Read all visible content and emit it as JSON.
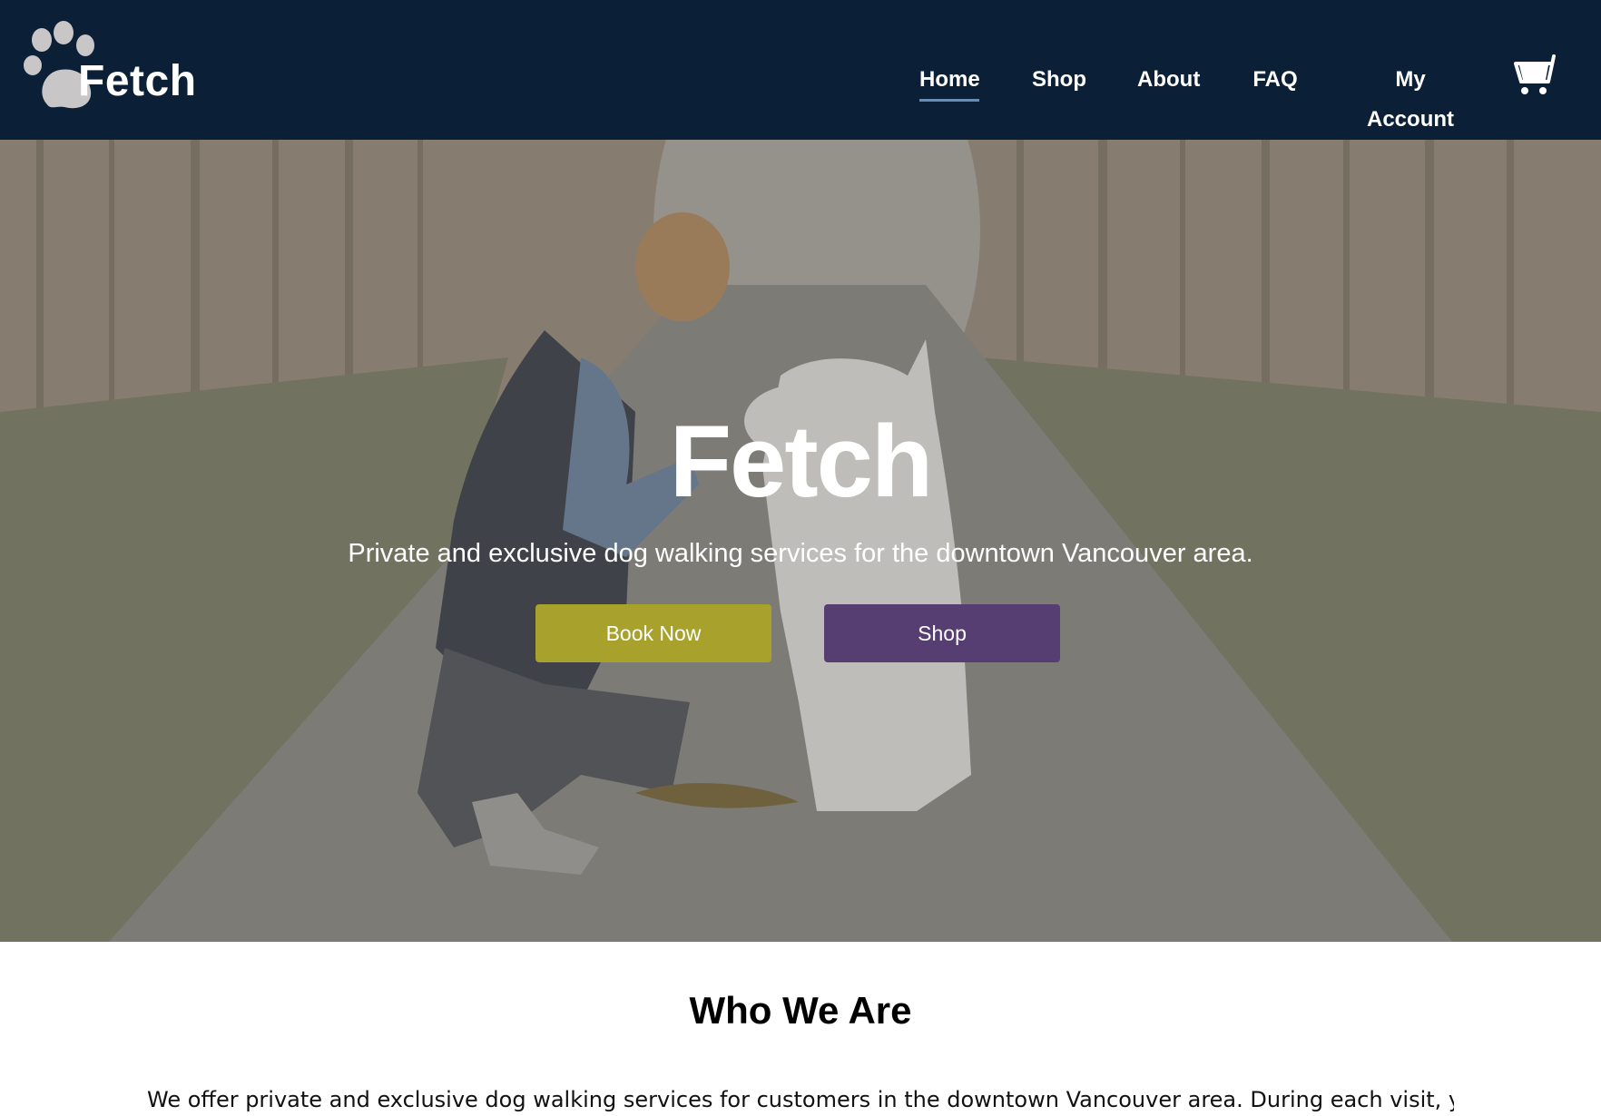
{
  "logo": {
    "text": "Fetch",
    "icon": "paw-icon"
  },
  "nav": {
    "items": [
      {
        "label": "Home",
        "active": true
      },
      {
        "label": "Shop",
        "active": false
      },
      {
        "label": "About",
        "active": false
      },
      {
        "label": "FAQ",
        "active": false
      },
      {
        "label": "My Account",
        "active": false
      }
    ],
    "cart_icon": "shopping-cart-icon"
  },
  "hero": {
    "title": "Fetch",
    "subtitle": "Private and exclusive dog walking services for the downtown Vancouver area.",
    "book_label": "Book Now",
    "shop_label": "Shop"
  },
  "about": {
    "title": "Who We Are",
    "text": "We offer private and exclusive dog walking services for customers in the downtown Vancouver area. During each visit, your dog"
  },
  "colors": {
    "header_bg": "#0b2037",
    "active_underline": "#5f8fbf",
    "book_button": "#a8a22c",
    "shop_button": "#563d72"
  }
}
